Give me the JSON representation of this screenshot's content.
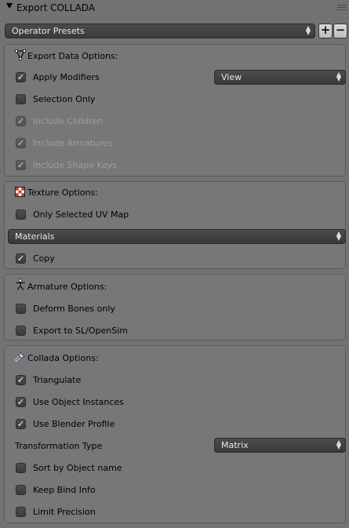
{
  "header": {
    "title": "Export COLLADA"
  },
  "presets": {
    "label": "Operator Presets"
  },
  "export_data": {
    "title": "Export Data Options:",
    "apply_modifiers": {
      "label": "Apply Modifiers",
      "checked": true
    },
    "modifiers_mode": "View",
    "selection_only": {
      "label": "Selection Only",
      "checked": false
    },
    "include_children": {
      "label": "Include Children",
      "checked": true,
      "enabled": false
    },
    "include_armatures": {
      "label": "Include Armatures",
      "checked": true,
      "enabled": false
    },
    "include_shape_keys": {
      "label": "Include Shape Keys",
      "checked": true,
      "enabled": false
    }
  },
  "texture": {
    "title": "Texture Options:",
    "only_selected_uv": {
      "label": "Only Selected UV Map",
      "checked": false
    },
    "materials_mode": "Materials",
    "copy": {
      "label": "Copy",
      "checked": true
    }
  },
  "armature": {
    "title": "Armature Options:",
    "deform_bones_only": {
      "label": "Deform Bones only",
      "checked": false
    },
    "export_sl": {
      "label": "Export to SL/OpenSim",
      "checked": false
    }
  },
  "collada": {
    "title": "Collada Options:",
    "triangulate": {
      "label": "Triangulate",
      "checked": true
    },
    "object_instances": {
      "label": "Use Object Instances",
      "checked": true
    },
    "blender_profile": {
      "label": "Use Blender Profile",
      "checked": true
    },
    "transformation_type_label": "Transformation Type",
    "transformation_type_value": "Matrix",
    "sort_by_name": {
      "label": "Sort by Object name",
      "checked": false
    },
    "keep_bind_info": {
      "label": "Keep Bind Info",
      "checked": false
    },
    "limit_precision": {
      "label": "Limit Precision",
      "checked": false
    }
  },
  "icons": {
    "collapse": "triangle-down-icon",
    "add": "plus-icon",
    "remove": "minus-icon",
    "export_data": "vertex-mesh-icon",
    "texture": "checker-texture-icon",
    "armature": "armature-figure-icon",
    "collada": "wrench-icon"
  }
}
